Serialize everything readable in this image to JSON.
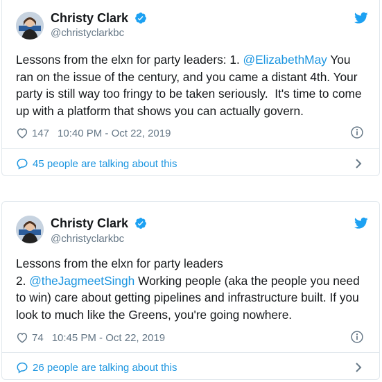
{
  "tweets": [
    {
      "author": "Christy Clark",
      "handle": "@christyclarkbc",
      "text_before": "Lessons from the elxn for party leaders: 1. ",
      "mention": "@ElizabethMay",
      "text_after": " You ran on the issue of the century, and you came a distant 4th. Your party is still way too fringy to be taken seriously.  It's time to come up with a platform that shows you can actually govern.",
      "likes": "147",
      "timestamp": "10:40 PM - Oct 22, 2019",
      "talking": "45 people are talking about this"
    },
    {
      "author": "Christy Clark",
      "handle": "@christyclarkbc",
      "text_before": "Lessons from the elxn for party leaders\n2. ",
      "mention": "@theJagmeetSingh",
      "text_after": " Working people (aka the people you need to win) care about getting pipelines and infrastructure built. If you look to much like the Greens, you're going nowhere.",
      "likes": "74",
      "timestamp": "10:45 PM - Oct 22, 2019",
      "talking": "26 people are talking about this"
    }
  ],
  "colors": {
    "link": "#1b95e0",
    "muted": "#657786",
    "verified": "#1da1f2",
    "border": "#e1e8ed"
  },
  "icons": {
    "avatar": "profile-photo",
    "verified": "verified-badge-icon",
    "brand": "twitter-bird-icon",
    "like": "heart-icon",
    "info": "info-icon",
    "reply": "speech-bubble-icon",
    "more": "chevron-right-icon"
  }
}
